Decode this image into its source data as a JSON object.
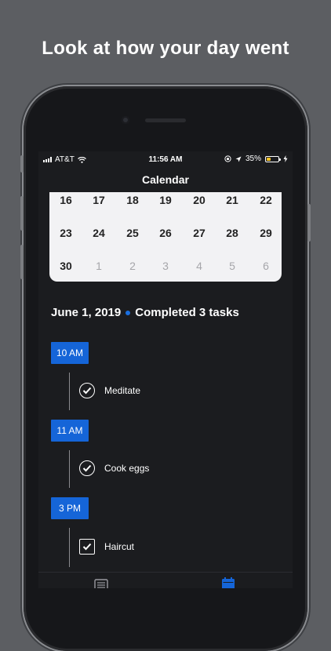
{
  "headline": "Look at how your day went",
  "status_bar": {
    "carrier": "AT&T",
    "time": "11:56 AM",
    "battery_percent": "35%",
    "battery_level": 0.35
  },
  "nav": {
    "title": "Calendar"
  },
  "calendar": {
    "weeks": [
      [
        {
          "d": "16",
          "muted": false
        },
        {
          "d": "17",
          "muted": false
        },
        {
          "d": "18",
          "muted": false
        },
        {
          "d": "19",
          "muted": false
        },
        {
          "d": "20",
          "muted": false
        },
        {
          "d": "21",
          "muted": false
        },
        {
          "d": "22",
          "muted": false
        }
      ],
      [
        {
          "d": "23",
          "muted": false
        },
        {
          "d": "24",
          "muted": false
        },
        {
          "d": "25",
          "muted": false
        },
        {
          "d": "26",
          "muted": false
        },
        {
          "d": "27",
          "muted": false
        },
        {
          "d": "28",
          "muted": false
        },
        {
          "d": "29",
          "muted": false
        }
      ],
      [
        {
          "d": "30",
          "muted": false
        },
        {
          "d": "1",
          "muted": true
        },
        {
          "d": "2",
          "muted": true
        },
        {
          "d": "3",
          "muted": true
        },
        {
          "d": "4",
          "muted": true
        },
        {
          "d": "5",
          "muted": true
        },
        {
          "d": "6",
          "muted": true
        }
      ]
    ]
  },
  "summary": {
    "date": "June 1, 2019",
    "completed": "Completed 3 tasks"
  },
  "timeline": [
    {
      "time": "10 AM",
      "task": "Meditate",
      "check": "circle"
    },
    {
      "time": "11 AM",
      "task": "Cook eggs",
      "check": "circle"
    },
    {
      "time": "3 PM",
      "task": "Haircut",
      "check": "square"
    }
  ],
  "tabbar": {
    "tabs": [
      {
        "icon": "list-icon",
        "active": false
      },
      {
        "icon": "calendar-icon",
        "active": true
      }
    ]
  },
  "colors": {
    "accent": "#1565d8",
    "background": "#5c5e62",
    "screen": "#1b1c1f",
    "calendar_bg": "#f2f2f4",
    "battery": "#f7c325"
  }
}
